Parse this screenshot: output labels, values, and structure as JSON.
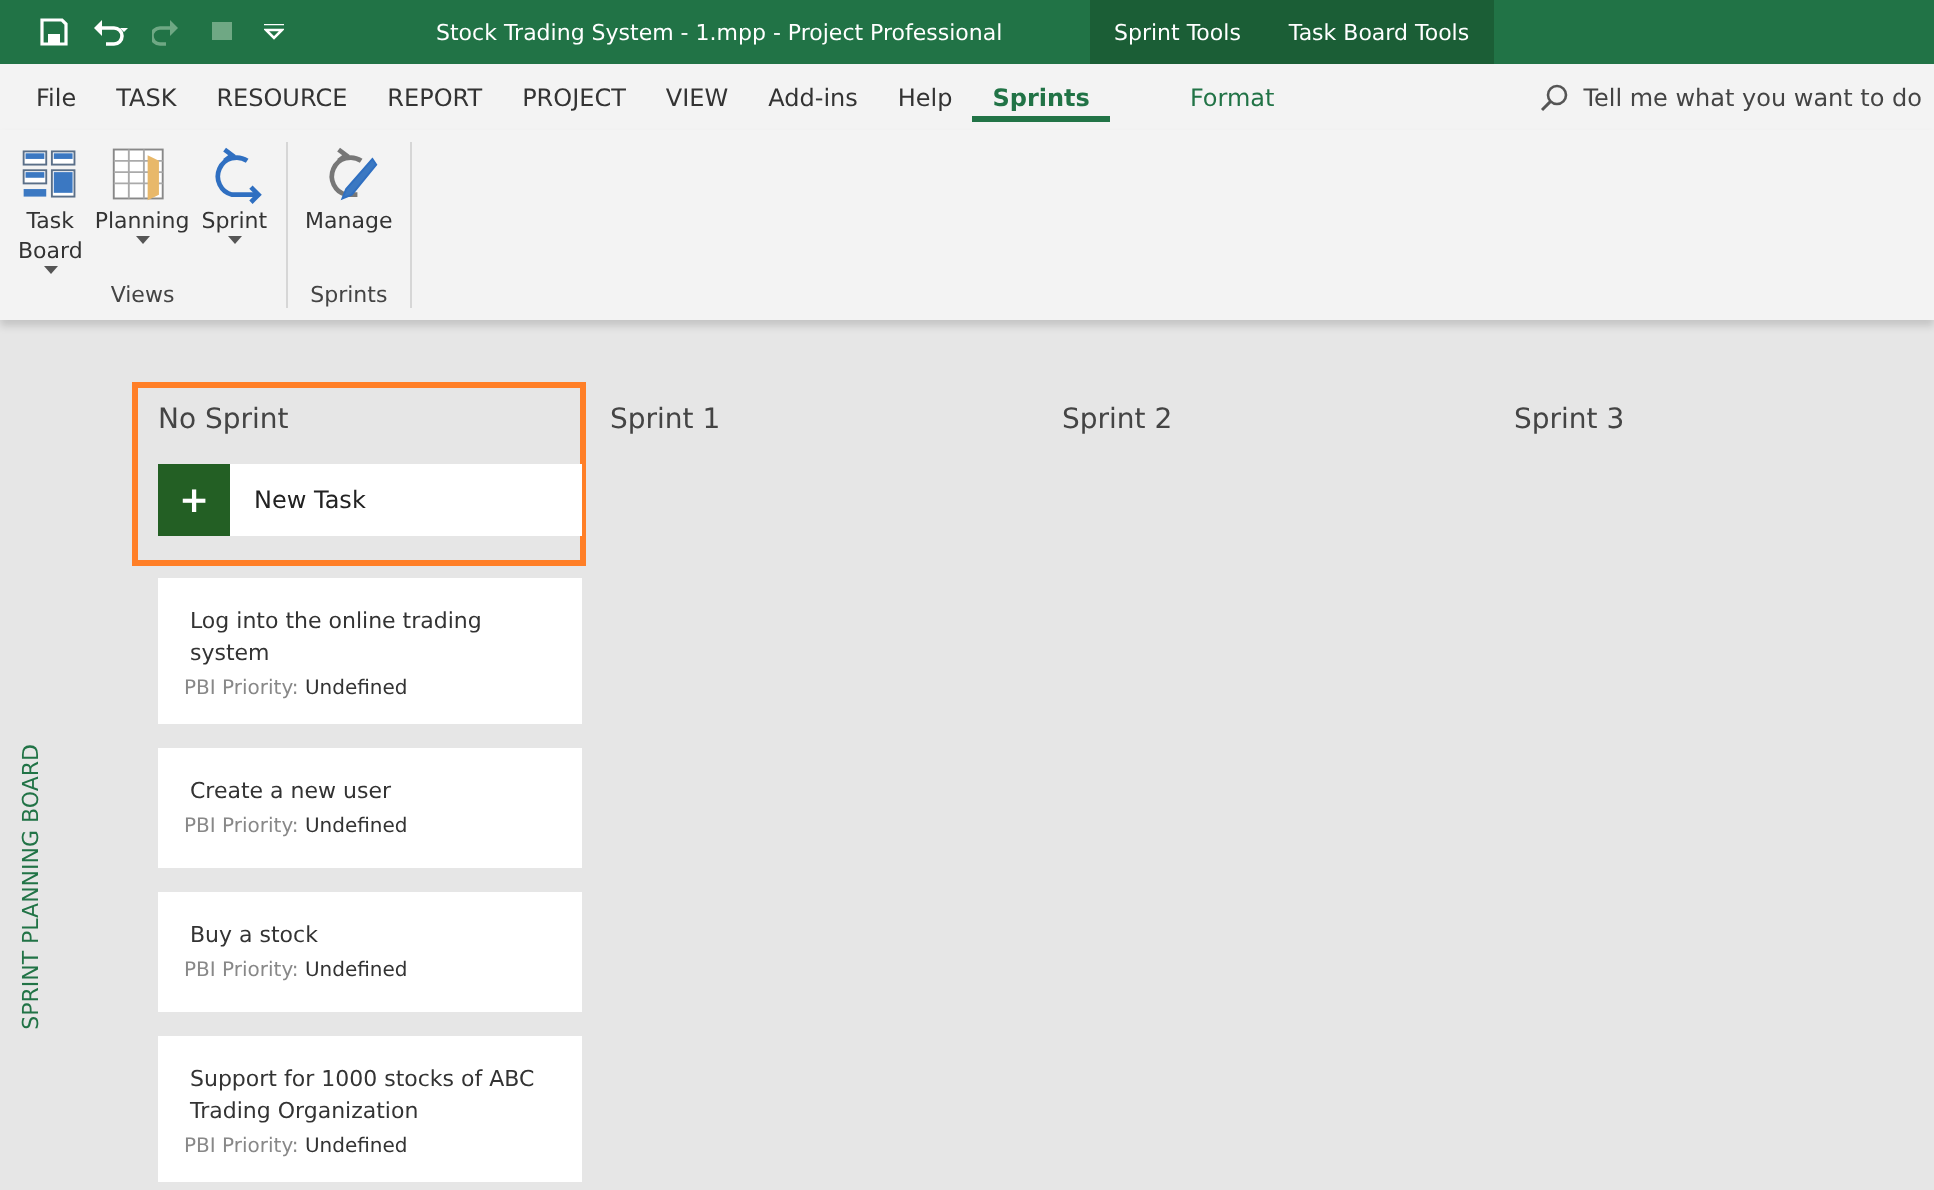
{
  "title_bar": {
    "title": "Stock Trading System - 1.mpp  -  Project Professional",
    "context_groups": [
      "Sprint Tools",
      "Task Board Tools"
    ]
  },
  "ribbon_tabs": [
    {
      "label": "File",
      "selected": false,
      "kind": "plain"
    },
    {
      "label": "TASK",
      "selected": false,
      "kind": "plain"
    },
    {
      "label": "RESOURCE",
      "selected": false,
      "kind": "plain"
    },
    {
      "label": "REPORT",
      "selected": false,
      "kind": "plain"
    },
    {
      "label": "PROJECT",
      "selected": false,
      "kind": "plain"
    },
    {
      "label": "VIEW",
      "selected": false,
      "kind": "plain"
    },
    {
      "label": "Add-ins",
      "selected": false,
      "kind": "plain"
    },
    {
      "label": "Help",
      "selected": false,
      "kind": "plain"
    },
    {
      "label": "Sprints",
      "selected": true,
      "kind": "context"
    },
    {
      "label": "Format",
      "selected": false,
      "kind": "context"
    }
  ],
  "tell_me": {
    "placeholder": "Tell me what you want to do"
  },
  "ribbon_groups": [
    {
      "label": "Views",
      "buttons": [
        {
          "label": "Task Board",
          "dropdown": true
        },
        {
          "label": "Planning",
          "dropdown": true
        },
        {
          "label": "Sprint",
          "dropdown": true
        }
      ]
    },
    {
      "label": "Sprints",
      "buttons": [
        {
          "label": "Manage",
          "dropdown": false
        }
      ]
    }
  ],
  "board": {
    "side_label": "SPRINT PLANNING BOARD",
    "new_task": {
      "icon": "+",
      "label": "New Task"
    },
    "columns": [
      {
        "title": "No Sprint",
        "selected": true,
        "cards": [
          {
            "title": "Log into the online trading system",
            "field": "PBI Priority:",
            "value": "Undefined"
          },
          {
            "title": "Create a new user",
            "field": "PBI Priority:",
            "value": "Undefined"
          },
          {
            "title": "Buy a stock",
            "field": "PBI Priority:",
            "value": "Undefined"
          },
          {
            "title": "Support for 1000 stocks of ABC Trading Organization",
            "field": "PBI Priority:",
            "value": "Undefined"
          }
        ]
      },
      {
        "title": "Sprint 1",
        "selected": false
      },
      {
        "title": "Sprint 2",
        "selected": false
      },
      {
        "title": "Sprint 3",
        "selected": false
      }
    ]
  }
}
